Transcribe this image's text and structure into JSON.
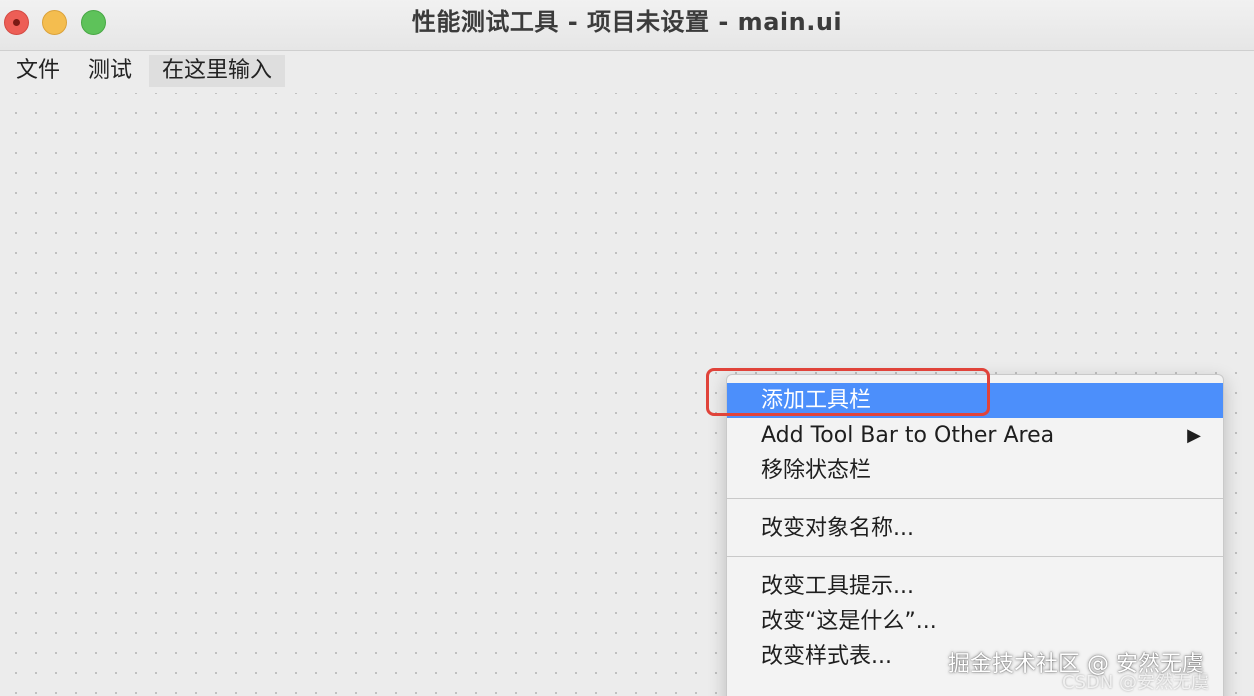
{
  "window": {
    "title": "性能测试工具 - 项目未设置 - main.ui"
  },
  "menubar": {
    "items": [
      "文件",
      "测试",
      "在这里输入"
    ]
  },
  "context_menu": {
    "group1": [
      {
        "label": "添加工具栏",
        "highlighted": true
      },
      {
        "label": "Add Tool Bar to Other Area",
        "submenu_arrow": "▶"
      },
      {
        "label": "移除状态栏"
      }
    ],
    "group2": [
      {
        "label": "改变对象名称..."
      }
    ],
    "group3": [
      {
        "label": "改变工具提示..."
      },
      {
        "label": "改变“这是什么”..."
      },
      {
        "label": "改变样式表..."
      }
    ]
  },
  "watermark": {
    "text": "掘金技术社区 @ 安然无虞",
    "sub": "CSDN @安然无虞"
  },
  "colors": {
    "highlight": "#4c8ffb",
    "annotation": "#e0433a",
    "close": "#ed5e56",
    "minimize": "#f4bd4f",
    "maximize": "#5ec25a"
  }
}
